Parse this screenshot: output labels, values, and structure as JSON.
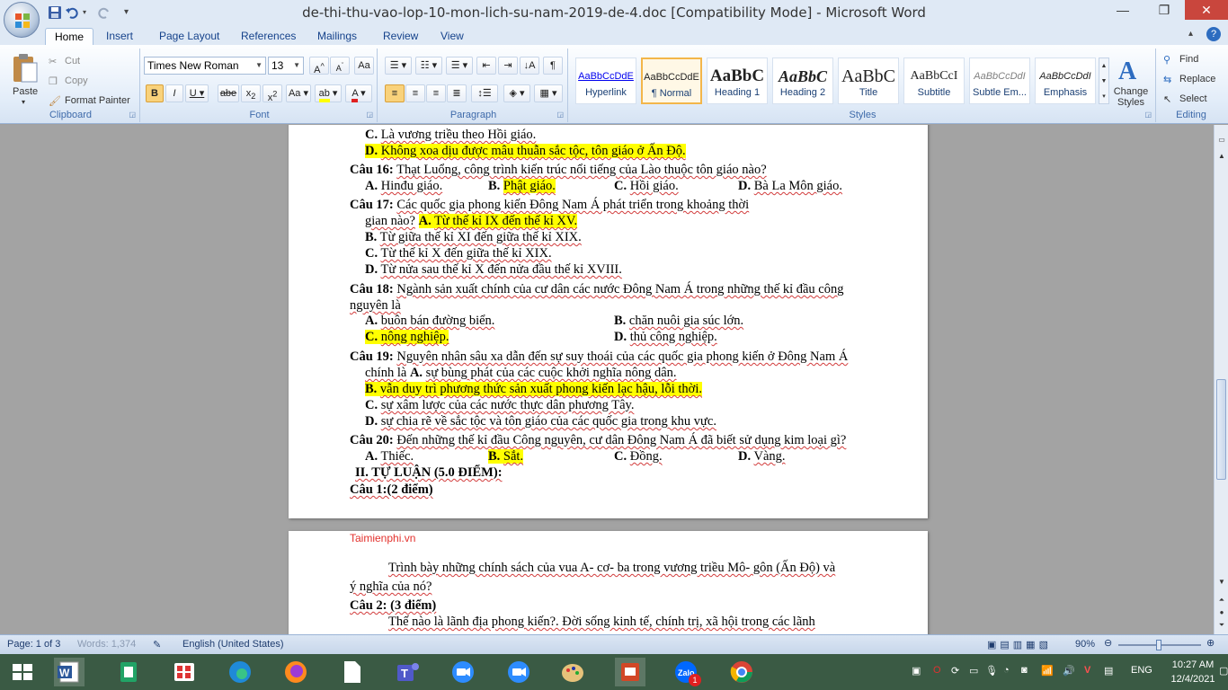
{
  "window": {
    "title": "de-thi-thu-vao-lop-10-mon-lich-su-nam-2019-de-4.doc [Compatibility Mode] - Microsoft Word",
    "minimize": "—",
    "restore": "❐",
    "close": "✕"
  },
  "tabs": [
    "Home",
    "Insert",
    "Page Layout",
    "References",
    "Mailings",
    "Review",
    "View"
  ],
  "ribbon": {
    "clipboard": {
      "label": "Clipboard",
      "paste": "Paste",
      "cut": "Cut",
      "copy": "Copy",
      "format_painter": "Format Painter"
    },
    "font": {
      "label": "Font",
      "font_name": "Times New Roman",
      "font_size": "13"
    },
    "paragraph": {
      "label": "Paragraph"
    },
    "styles": {
      "label": "Styles",
      "items": [
        {
          "sample": "AaBbCcDdE",
          "name": "Hyperlink"
        },
        {
          "sample": "AaBbCcDdE",
          "name": "¶ Normal"
        },
        {
          "sample": "AaBbC",
          "name": "Heading 1"
        },
        {
          "sample": "AaBbC",
          "name": "Heading 2"
        },
        {
          "sample": "AaBbC",
          "name": "Title"
        },
        {
          "sample": "AaBbCcI",
          "name": "Subtitle"
        },
        {
          "sample": "AaBbCcDdI",
          "name": "Subtle Em..."
        },
        {
          "sample": "AaBbCcDdI",
          "name": "Emphasis"
        }
      ],
      "change_styles": "Change Styles"
    },
    "editing": {
      "label": "Editing",
      "find": "Find",
      "replace": "Replace",
      "select": "Select"
    }
  },
  "document": {
    "page1": {
      "l1": {
        "label": "C.",
        "text": "Là vương triều theo Hồi giáo."
      },
      "l2": {
        "label": "D.",
        "text": "Không xoa dịu được mâu thuẫn sắc tộc, tôn giáo ở Ấn Độ."
      },
      "q16": {
        "label": "Câu 16:",
        "text": "Thạt Luổng, công trình kiến trúc nổi tiếng của Lào thuộc tôn giáo nào?"
      },
      "q16a": {
        "label": "A.",
        "text": "Hinđu giáo."
      },
      "q16b": {
        "label": "B.",
        "text": "Phật giáo."
      },
      "q16c": {
        "label": "C.",
        "text": "Hồi giáo."
      },
      "q16d": {
        "label": "D.",
        "text": "Bà La Môn giáo."
      },
      "q17": {
        "label": "Câu 17:",
        "text": "Các quốc gia phong kiến Đông Nam Á phát triển trong khoảng thời"
      },
      "q17b": {
        "text": "gian nào?",
        "label": "A.",
        "answer": "Từ thế kỉ IX đến thế kỉ XV."
      },
      "q17B": {
        "label": "B.",
        "text": "Từ giữa thế kỉ XI đến giữa thế kỉ XIX."
      },
      "q17C": {
        "label": "C.",
        "text": "Từ thế kỉ X đến giữa thế kỉ XIX."
      },
      "q17D": {
        "label": "D.",
        "text": "Từ nửa sau thế kỉ X đến nửa đầu thế kỉ XVIII."
      },
      "q18": {
        "label": "Câu 18:",
        "text": "Ngành sản xuất chính của cư dân các nước Đông Nam Á trong những thế kỉ đầu công"
      },
      "q18b": {
        "text": "nguyên là"
      },
      "q18A": {
        "label": "A.",
        "text": "buôn bán đường biển."
      },
      "q18B": {
        "label": "B.",
        "text": "chăn nuôi gia súc lớn."
      },
      "q18C": {
        "label": "C.",
        "text": "nông nghiệp."
      },
      "q18D": {
        "label": "D.",
        "text": "thủ công nghiệp."
      },
      "q19": {
        "label": "Câu 19:",
        "text": "Nguyên nhân sâu xa dẫn đến sự suy thoái của các quốc gia phong kiến ở Đông Nam Á"
      },
      "q19b": {
        "text": "chính là",
        "label": "A.",
        "text2": "sự bùng phát của các cuộc khởi nghĩa nông dân."
      },
      "q19B": {
        "label": "B.",
        "text": "vẫn duy trì phương thức sản xuất phong kiến lạc hậu, lỗi thời."
      },
      "q19C": {
        "label": "C.",
        "text": "sự xâm lược của các nước thực dân phương Tây."
      },
      "q19D": {
        "label": "D.",
        "text": "sự chia rẽ về sắc tộc và tôn giáo của các quốc gia trong khu vực."
      },
      "q20": {
        "label": "Câu 20:",
        "text": "Đến những thế kỉ đầu Công nguyên, cư dân Đông Nam Á đã biết sử dụng kim loại gì?"
      },
      "q20A": {
        "label": "A.",
        "text": "Thiếc."
      },
      "q20B": {
        "label": "B.",
        "text": "Sắt."
      },
      "q20C": {
        "label": "C.",
        "text": "Đồng."
      },
      "q20D": {
        "label": "D.",
        "text": "Vàng."
      },
      "section2": "II. TỰ LUẬN (5.0 ĐIỂM):",
      "cau1": "Câu 1:(2 điểm)"
    },
    "page2": {
      "watermark": "Taimienphi.vn",
      "p1": "Trình bày những chính sách của vua A- cơ- ba trong vương triều Mô- gôn (Ấn Độ) và",
      "p1b": "ý nghĩa của nó?",
      "cau2": "Câu 2: (3 điểm)",
      "p2": "Thế nào là lãnh địa phong kiến?. Đời sống kinh tế, chính trị, xã hội trong các lãnh"
    }
  },
  "statusbar": {
    "page": "Page: 1 of 3",
    "words": "Words: 1,374",
    "language": "English (United States)",
    "zoom": "90%"
  },
  "taskbar": {
    "lang": "ENG",
    "time": "10:27 AM",
    "date": "12/4/2021",
    "zalo_badge": "1"
  },
  "colors": {
    "highlight": "#ffff00",
    "taskbar": "#3a5a44",
    "ribbon": "#dfe9f5"
  }
}
